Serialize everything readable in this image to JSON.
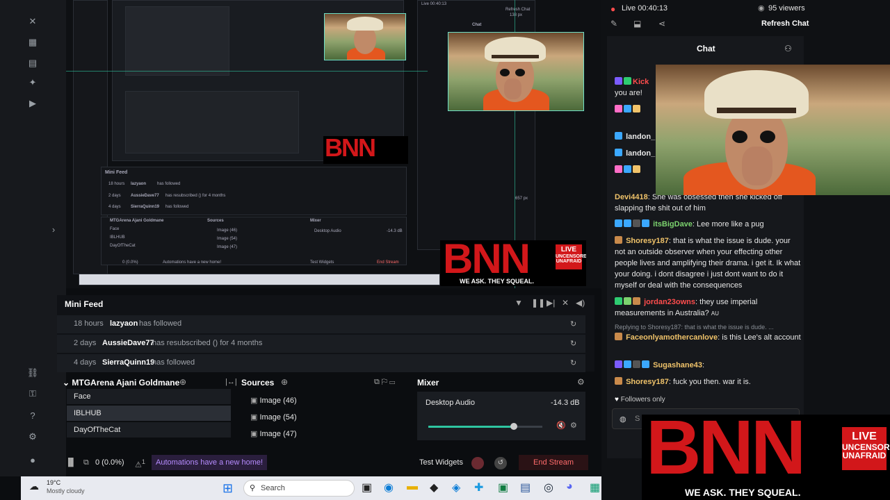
{
  "stream": {
    "status": "Live 00:40:13",
    "viewers": "95 viewers",
    "refresh_chat": "Refresh Chat",
    "chat_title": "Chat"
  },
  "nested_preview": {
    "live_label": "Live 00:40:13",
    "refresh_chat": "Refresh Chat",
    "chat_title": "Chat",
    "minifeed_title": "Mini Feed",
    "scene": "MTGArena Ajani Goldmane",
    "sources_title": "Sources",
    "mixer_title": "Mixer",
    "scenes": [
      "Face",
      "IBLHUB",
      "DayOfTheCat"
    ],
    "sources": [
      "Image (46)",
      "Image (54)",
      "Image (47)"
    ],
    "desktop_audio": "Desktop Audio",
    "db": "-14.3 dB",
    "automations": "Automations have a new home!",
    "test_widgets": "Test Widgets",
    "end_stream": "End Stream",
    "stat": "0 (0.0%)",
    "feed": [
      {
        "time": "18 hours",
        "user": "lazyaon",
        "action": "has followed"
      },
      {
        "time": "2 days",
        "user": "AussieDave77",
        "action": "has resubscribed () for 4 months"
      },
      {
        "time": "4 days",
        "user": "SierraQuinn19",
        "action": "has followed"
      }
    ],
    "dim_label": "657 px",
    "dim_label2": "138 px"
  },
  "minifeed": {
    "title": "Mini Feed",
    "rows": [
      {
        "time": "18 hours",
        "user": "lazyaon",
        "action": "has followed"
      },
      {
        "time": "2 days",
        "user": "AussieDave77",
        "action": "has resubscribed () for 4 months"
      },
      {
        "time": "4 days",
        "user": "SierraQuinn19",
        "action": "has followed"
      }
    ]
  },
  "scenes": {
    "title": "MTGArena Ajani Goldmane",
    "items": [
      "Face",
      "IBLHUB",
      "DayOfTheCat"
    ],
    "selected": "IBLHUB"
  },
  "sources": {
    "title": "Sources",
    "items": [
      "Image (46)",
      "Image (54)",
      "Image (47)"
    ]
  },
  "mixer": {
    "title": "Mixer",
    "channel": "Desktop Audio",
    "level": "-14.3 dB",
    "volume_fraction": 0.75
  },
  "bottom": {
    "stat": "0 (0.0%)",
    "alert_count": "1",
    "automations": "Automations have a new home!",
    "test_widgets": "Test Widgets",
    "end_stream": "End Stream"
  },
  "bnn": {
    "letters": "BNN",
    "tagline": "WE ASK. THEY SQUEAL.",
    "live": "LIVE",
    "uncensored": "UNCENSORED",
    "unafraid": "UNAFRAID"
  },
  "taskbar": {
    "temp": "19°C",
    "weather": "Mostly cloudy",
    "search": "Search"
  },
  "chat": {
    "partial_top": "you are!",
    "messages": [
      {
        "user": "Kick",
        "text": "",
        "color": "#ff4d4d"
      },
      {
        "user": "landon_",
        "text": "",
        "color": "#ffffff"
      },
      {
        "user": "landon_",
        "text": "",
        "color": "#ffffff"
      },
      {
        "user": "Devi4418",
        "text": "She was obsessed then she kicked off slapping the shit out of him",
        "color": "#f0c36a"
      },
      {
        "user": "itsBigDave",
        "text": "Lee more like a pug",
        "color": "#7cd36e"
      },
      {
        "user": "Shoresy187",
        "text": "that is what the issue is dude. your not an outside observer when your effecting other people lives and amplifying their drama. i get it. Ik what your doing. i dont disagree i just dont want to do it myself or deal with the consequences",
        "color": "#f0c36a"
      },
      {
        "user": "jordan23owns",
        "text": "they use imperial measurements in Australia?",
        "color": "#ff4d4d"
      },
      {
        "user": "Faceonlyamothercanlove",
        "text": "is this Lee's alt account",
        "color": "#f0c36a"
      },
      {
        "user": "Sugashane43",
        "text": "",
        "color": "#f0c36a"
      },
      {
        "user": "Shoresy187",
        "text": "fuck you then. war it is.",
        "color": "#f0c36a"
      }
    ],
    "reply_context": "Replying to Shoresy187: that is what the issue is dude. ...",
    "followers_only": "Followers only",
    "input_placeholder": "S",
    "suffix": "AU"
  }
}
